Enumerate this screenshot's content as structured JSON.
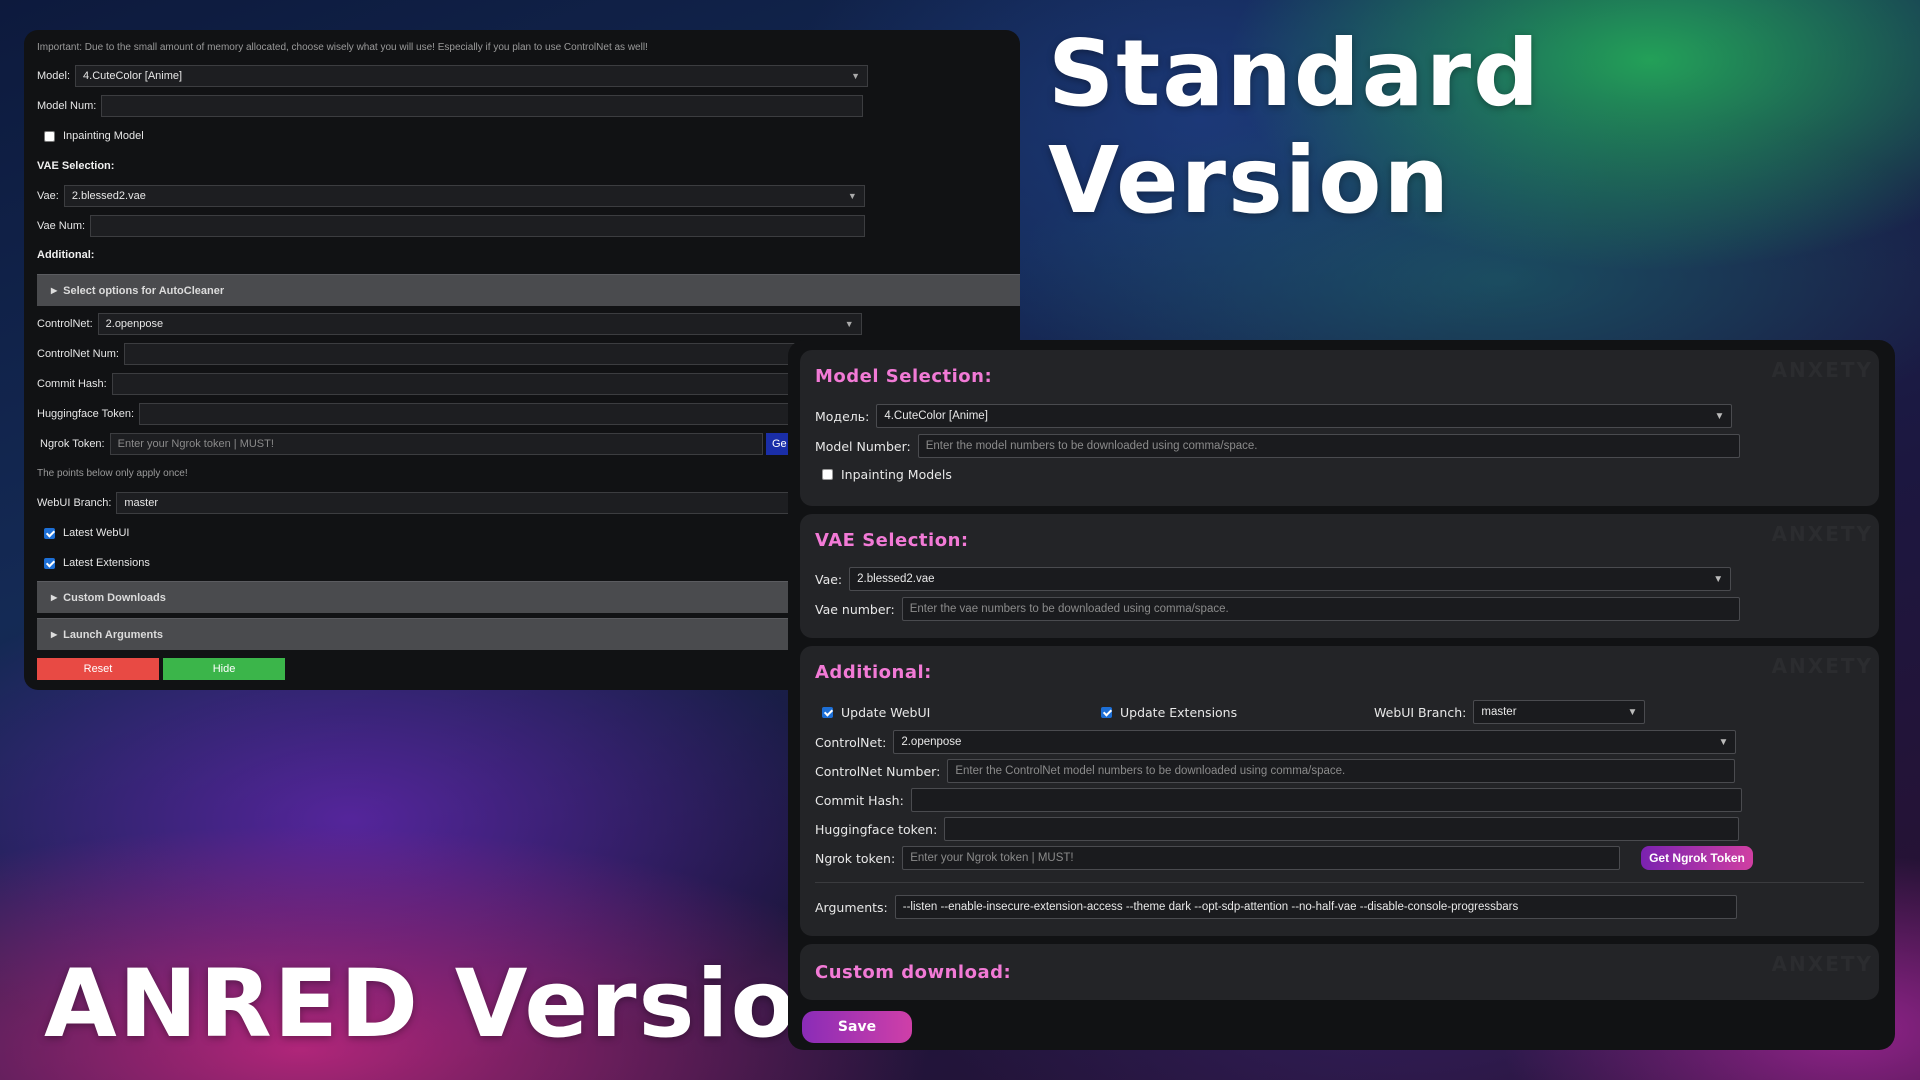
{
  "titles": {
    "standard": "Standard Version",
    "anred": "ANRED Version"
  },
  "standard": {
    "notice": "Important: Due to the small amount of memory allocated, choose wisely what you will use! Especially if you plan to use ControlNet as well!",
    "model_label": "Model:",
    "model_value": "4.CuteColor [Anime]",
    "model_num_label": "Model Num:",
    "inpainting_label": "Inpainting Model",
    "vae_heading": "VAE Selection:",
    "vae_label": "Vae:",
    "vae_value": "2.blessed2.vae",
    "vae_num_label": "Vae Num:",
    "additional_heading": "Additional:",
    "autocleaner_label": "Select options for AutoCleaner",
    "controlnet_label": "ControlNet:",
    "controlnet_value": "2.openpose",
    "controlnet_num_label": "ControlNet Num:",
    "commit_hash_label": "Commit Hash:",
    "hf_token_label": "Huggingface Token:",
    "ngrok_label": "Ngrok Token:",
    "ngrok_placeholder": "Enter your Ngrok token | MUST!",
    "ngrok_button_partial": "Ge",
    "once_note": "The points below only apply once!",
    "branch_label": "WebUI Branch:",
    "branch_value": "master",
    "latest_webui_label": "Latest WebUI",
    "latest_ext_label": "Latest Extensions",
    "custom_downloads_label": "Custom Downloads",
    "launch_args_label": "Launch Arguments",
    "reset_label": "Reset",
    "hide_label": "Hide"
  },
  "anred": {
    "watermark": "ANXETY",
    "model_section_title": "Model Selection:",
    "model_label": "Модель:",
    "model_value": "4.CuteColor [Anime]",
    "model_number_label": "Model Number:",
    "model_number_placeholder": "Enter the model numbers to be downloaded using comma/space.",
    "inpainting_label": "Inpainting Models",
    "vae_section_title": "VAE Selection:",
    "vae_label": "Vae:",
    "vae_value": "2.blessed2.vae",
    "vae_number_label": "Vae number:",
    "vae_number_placeholder": "Enter the vae numbers to be downloaded using comma/space.",
    "additional_section_title": "Additional:",
    "update_webui_label": "Update WebUI",
    "update_ext_label": "Update Extensions",
    "branch_label": "WebUI Branch:",
    "branch_value": "master",
    "controlnet_label": "ControlNet:",
    "controlnet_value": "2.openpose",
    "controlnet_number_label": "ControlNet Number:",
    "controlnet_number_placeholder": "Enter the ControlNet model numbers to be downloaded using comma/space.",
    "commit_hash_label": "Commit Hash:",
    "hf_token_label": "Huggingface token:",
    "ngrok_label": "Ngrok token:",
    "ngrok_placeholder": "Enter your Ngrok token | MUST!",
    "ngrok_button": "Get Ngrok Token",
    "arguments_label": "Arguments:",
    "arguments_value": "--listen --enable-insecure-extension-access --theme dark --opt-sdp-attention --no-half-vae --disable-console-progressbars",
    "custom_download_title": "Custom download:",
    "save_label": "Save"
  },
  "colors": {
    "section_title_pink": "#f27ad6",
    "reset_red": "#e84a44",
    "hide_green": "#3bb54a",
    "checkbox_blue": "#1d6fd6"
  }
}
